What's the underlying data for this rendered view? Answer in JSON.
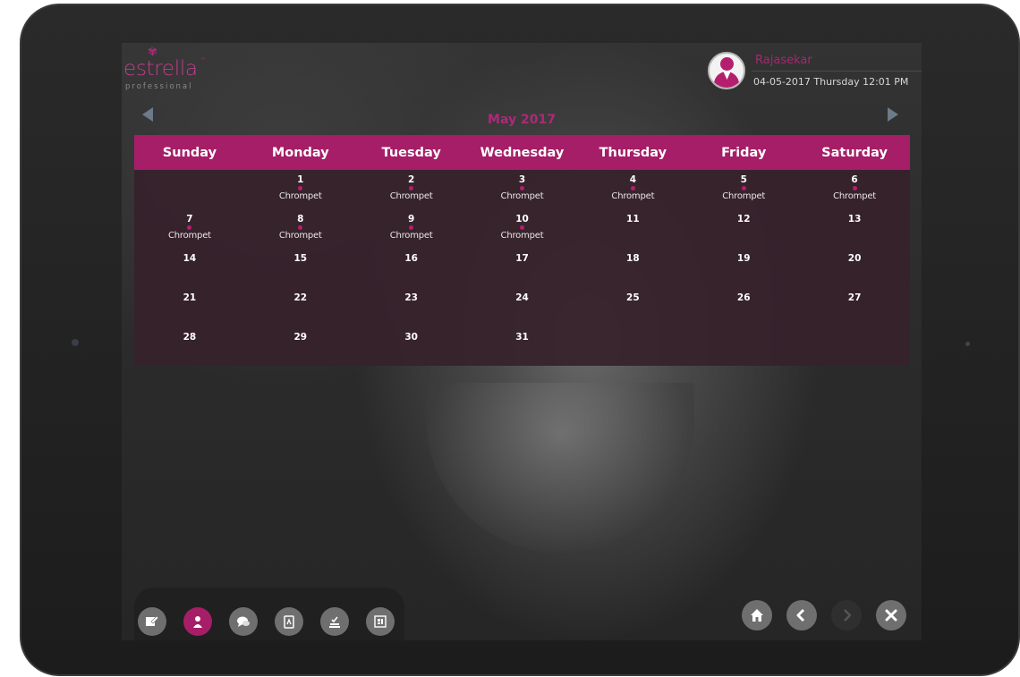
{
  "brand": {
    "name": "estrella",
    "tagline": "professional",
    "accent": "#a51e67"
  },
  "user": {
    "name": "Rajasekar",
    "datetime": "04-05-2017  Thursday  12:01 PM",
    "avatar_icon": "user-avatar-icon"
  },
  "calendar": {
    "month_label": "May 2017",
    "prev_icon": "triangle-left-icon",
    "next_icon": "triangle-right-icon",
    "weekdays": [
      "Sunday",
      "Monday",
      "Tuesday",
      "Wednesday",
      "Thursday",
      "Friday",
      "Saturday"
    ],
    "weeks": [
      [
        {
          "day": "",
          "event": ""
        },
        {
          "day": "1",
          "event": "Chrompet"
        },
        {
          "day": "2",
          "event": "Chrompet"
        },
        {
          "day": "3",
          "event": "Chrompet"
        },
        {
          "day": "4",
          "event": "Chrompet"
        },
        {
          "day": "5",
          "event": "Chrompet"
        },
        {
          "day": "6",
          "event": "Chrompet"
        }
      ],
      [
        {
          "day": "7",
          "event": "Chrompet"
        },
        {
          "day": "8",
          "event": "Chrompet"
        },
        {
          "day": "9",
          "event": "Chrompet"
        },
        {
          "day": "10",
          "event": "Chrompet"
        },
        {
          "day": "11",
          "event": ""
        },
        {
          "day": "12",
          "event": ""
        },
        {
          "day": "13",
          "event": ""
        }
      ],
      [
        {
          "day": "14",
          "event": ""
        },
        {
          "day": "15",
          "event": ""
        },
        {
          "day": "16",
          "event": ""
        },
        {
          "day": "17",
          "event": ""
        },
        {
          "day": "18",
          "event": ""
        },
        {
          "day": "19",
          "event": ""
        },
        {
          "day": "20",
          "event": ""
        }
      ],
      [
        {
          "day": "21",
          "event": ""
        },
        {
          "day": "22",
          "event": ""
        },
        {
          "day": "23",
          "event": ""
        },
        {
          "day": "24",
          "event": ""
        },
        {
          "day": "25",
          "event": ""
        },
        {
          "day": "26",
          "event": ""
        },
        {
          "day": "27",
          "event": ""
        }
      ],
      [
        {
          "day": "28",
          "event": ""
        },
        {
          "day": "29",
          "event": ""
        },
        {
          "day": "30",
          "event": ""
        },
        {
          "day": "31",
          "event": ""
        },
        {
          "day": "",
          "event": ""
        },
        {
          "day": "",
          "event": ""
        },
        {
          "day": "",
          "event": ""
        }
      ]
    ]
  },
  "toolbar": {
    "tools": [
      {
        "icon": "note-edit-icon",
        "active": false
      },
      {
        "icon": "stylist-icon",
        "active": true
      },
      {
        "icon": "chat-icon",
        "active": false
      },
      {
        "icon": "clipboard-icon",
        "active": false
      },
      {
        "icon": "approve-stamp-icon",
        "active": false
      },
      {
        "icon": "report-icon",
        "active": false
      }
    ]
  },
  "navigation": {
    "home_icon": "home-icon",
    "back_icon": "chevron-left-icon",
    "forward_icon": "chevron-right-icon",
    "close_icon": "close-icon"
  }
}
